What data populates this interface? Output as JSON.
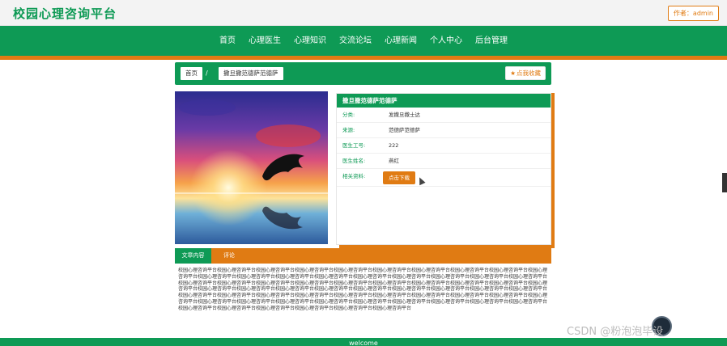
{
  "header": {
    "brand": "校园心理咨询平台",
    "author_label": "作者：admin"
  },
  "nav": {
    "items": [
      "首页",
      "心理医生",
      "心理知识",
      "交流论坛",
      "心理新闻",
      "个人中心",
      "后台管理"
    ]
  },
  "breadcrumb": {
    "home": "首页",
    "separator": "/",
    "current": "撒旦撒范德萨范德萨",
    "favorite": "点我收藏"
  },
  "detail": {
    "title": "撒旦撒范德萨范德萨",
    "fields": [
      {
        "key": "分类:",
        "value": "发撒旦撒士达"
      },
      {
        "key": "来源:",
        "value": "范德萨范德萨"
      },
      {
        "key": "医生工号:",
        "value": "222"
      },
      {
        "key": "医生姓名:",
        "value": "燕红"
      }
    ],
    "download_key": "相关资料:",
    "download_label": "点击下载"
  },
  "tabs": {
    "content": "文章内容",
    "comments": "评论"
  },
  "article": {
    "text": "校园心理咨询平台校园心理咨询平台校园心理咨询平台校园心理咨询平台校园心理咨询平台校园心理咨询平台校园心理咨询平台校园心理咨询平台校园心理咨询平台校园心理咨询平台校园心理咨询平台校园心理咨询平台校园心理咨询平台校园心理咨询平台校园心理咨询平台校园心理咨询平台校园心理咨询平台校园心理咨询平台校园心理咨询平台校园心理咨询平台校园心理咨询平台校园心理咨询平台校园心理咨询平台校园心理咨询平台校园心理咨询平台校园心理咨询平台校园心理咨询平台校园心理咨询平台校园心理咨询平台校园心理咨询平台校园心理咨询平台校园心理咨询平台校园心理咨询平台校园心理咨询平台校园心理咨询平台校园心理咨询平台校园心理咨询平台校园心理咨询平台校园心理咨询平台校园心理咨询平台校园心理咨询平台校园心理咨询平台校园心理咨询平台校园心理咨询平台校园心理咨询平台校园心理咨询平台校园心理咨询平台校园心理咨询平台校园心理咨询平台校园心理咨询平台校园心理咨询平台校园心理咨询平台校园心理咨询平台校园心理咨询平台校园心理咨询平台校园心理咨询平台校园心理咨询平台校园心理咨询平台校园心理咨询平台校园心理咨询平台校园心理咨询平台校园心理咨询平台校园心理咨询平台"
  },
  "footer": {
    "text": "welcome"
  },
  "watermark": "CSDN @粉泡泡毕设",
  "colors": {
    "primary": "#0e9a55",
    "accent": "#e07b13"
  },
  "icons": {
    "favorite": "star-icon",
    "cursor": "mouse-pointer-icon"
  }
}
